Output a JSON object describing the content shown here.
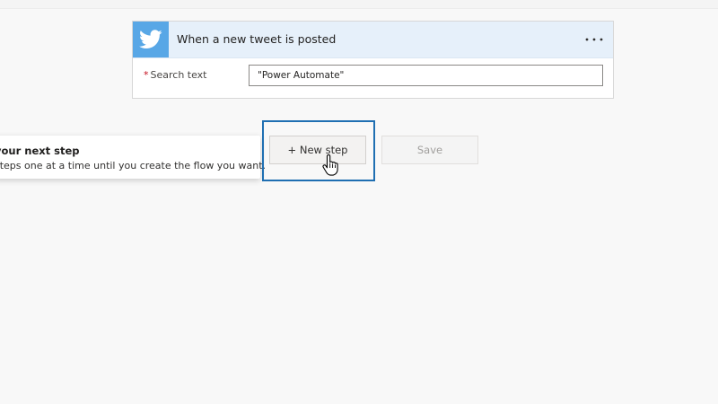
{
  "trigger": {
    "title": "When a new tweet is posted",
    "icon": "twitter-bird-icon",
    "more_icon": "ellipsis-icon",
    "field": {
      "label": "Search text",
      "required": true,
      "value": "\"Power Automate\""
    }
  },
  "tooltip": {
    "title": "your next step",
    "text": "steps one at a time until you create the flow you want."
  },
  "actions": {
    "new_step_label": "+ New step",
    "save_label": "Save"
  },
  "colors": {
    "twitter_blue": "#58a7e6",
    "card_header_bg": "#e6f0fa",
    "highlight_border": "#1f6fb2",
    "required_asterisk": "#c50f1f"
  }
}
